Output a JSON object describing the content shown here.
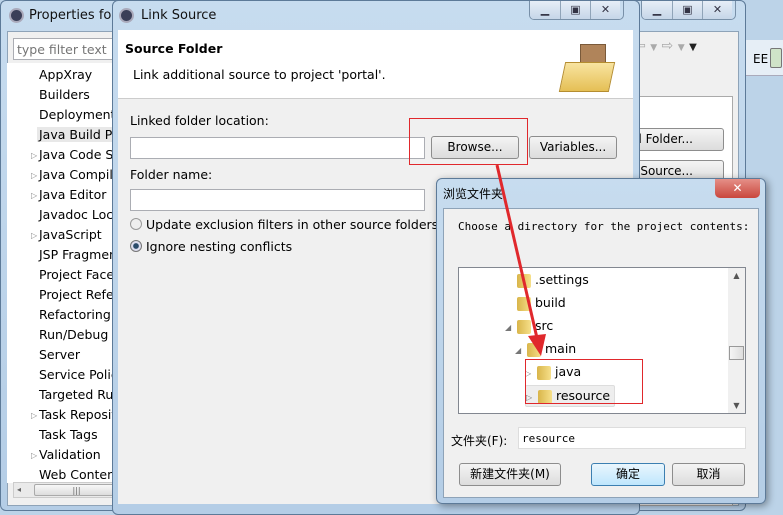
{
  "properties": {
    "title": "Properties for",
    "filter_placeholder": "type filter text",
    "items": [
      {
        "label": "AppXray",
        "exp": false
      },
      {
        "label": "Builders",
        "exp": false
      },
      {
        "label": "Deployment",
        "exp": false
      },
      {
        "label": "Java Build Pa",
        "exp": false,
        "selected": true
      },
      {
        "label": "Java Code St",
        "exp": true
      },
      {
        "label": "Java Compile",
        "exp": true
      },
      {
        "label": "Java Editor",
        "exp": true
      },
      {
        "label": "Javadoc Loca",
        "exp": false
      },
      {
        "label": "JavaScript",
        "exp": true
      },
      {
        "label": "JSP Fragmen",
        "exp": false
      },
      {
        "label": "Project Facet",
        "exp": false
      },
      {
        "label": "Project Refer",
        "exp": false
      },
      {
        "label": "Refactoring",
        "exp": false
      },
      {
        "label": "Run/Debug S",
        "exp": false
      },
      {
        "label": "Server",
        "exp": false
      },
      {
        "label": "Service Polic",
        "exp": false
      },
      {
        "label": "Targeted Ru",
        "exp": false
      },
      {
        "label": "Task Reposit",
        "exp": true
      },
      {
        "label": "Task Tags",
        "exp": false
      },
      {
        "label": "Validation",
        "exp": true
      },
      {
        "label": "Web Conten",
        "exp": false
      }
    ],
    "add_folder": "d Folder...",
    "link_source": "k Source...",
    "perspective": "EE"
  },
  "link_source": {
    "title": "Link Source",
    "header_title": "Source Folder",
    "header_desc": "Link additional source to project 'portal'.",
    "linked_label": "Linked folder location:",
    "linked_value": "",
    "browse": "Browse...",
    "variables": "Variables...",
    "folder_label": "Folder name:",
    "folder_value": "",
    "opt_update": "Update exclusion filters in other source folders to",
    "opt_ignore": "Ignore nesting conflicts",
    "selected_option": "ignore"
  },
  "browse_dialog": {
    "title": "浏览文件夹",
    "prompt": "Choose a directory for the project contents:",
    "tree": [
      {
        "label": ".settings",
        "level": 0,
        "arrow": ""
      },
      {
        "label": "build",
        "level": 0,
        "arrow": ""
      },
      {
        "label": "src",
        "level": 0,
        "arrow": "◢"
      },
      {
        "label": "main",
        "level": 1,
        "arrow": "◢"
      },
      {
        "label": "java",
        "level": 2,
        "arrow": "▷"
      },
      {
        "label": "resource",
        "level": 2,
        "arrow": "▷",
        "selected": true
      }
    ],
    "folder_label": "文件夹(F):",
    "folder_value": "resource",
    "new_folder": "新建文件夹(M)",
    "ok": "确定",
    "cancel": "取消"
  },
  "colors": {
    "annotation": "#e0282c",
    "close": "#c9463d"
  }
}
